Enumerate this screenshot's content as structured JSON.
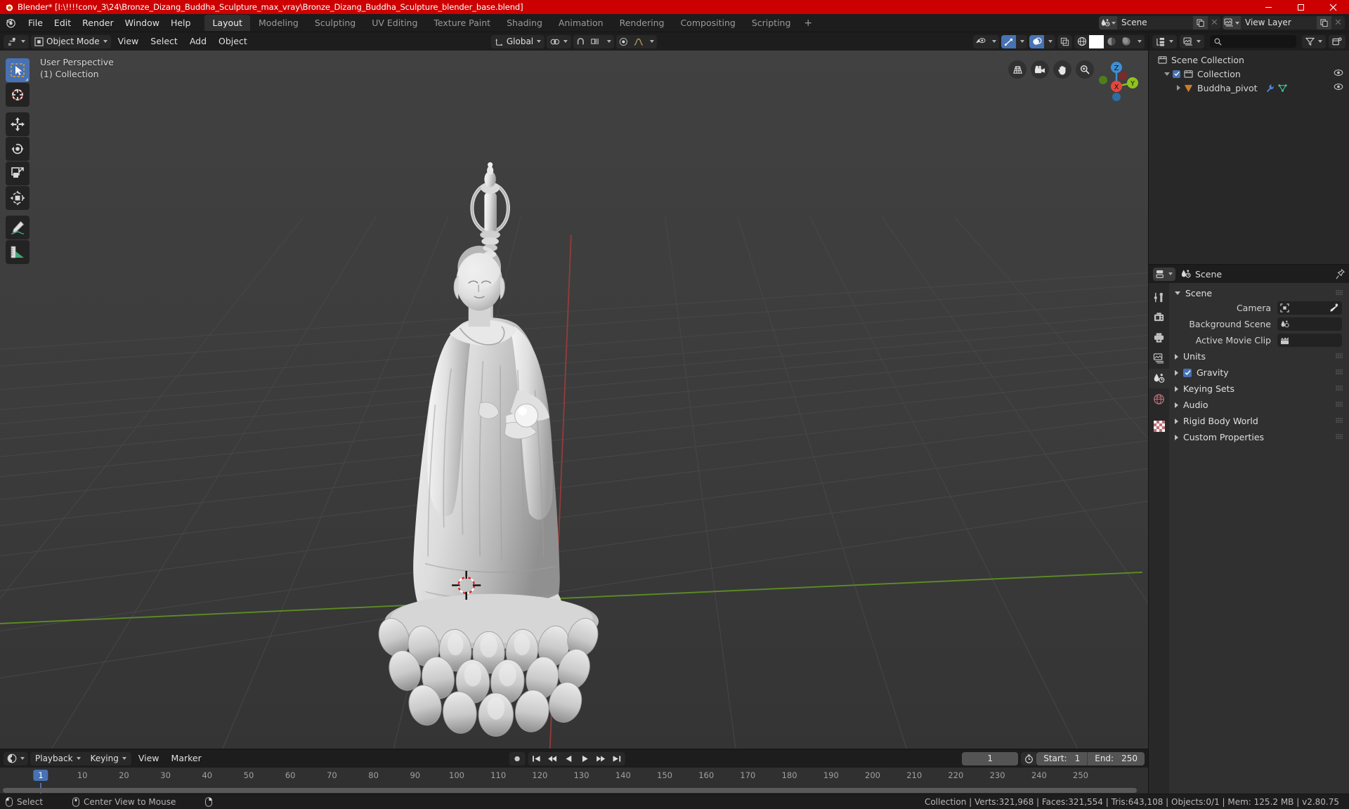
{
  "titlebar": {
    "title": "Blender* [I:\\!!!!conv_3\\24\\Bronze_Dizang_Buddha_Sculpture_max_vray\\Bronze_Dizang_Buddha_Sculpture_blender_base.blend]",
    "accent_color": "#cc0000",
    "minimize": "–",
    "maximize": "❐",
    "close": "✕"
  },
  "topbar": {
    "menus": [
      "File",
      "Edit",
      "Render",
      "Window",
      "Help"
    ],
    "workspace_tabs": [
      {
        "label": "Layout",
        "active": true
      },
      {
        "label": "Modeling",
        "active": false
      },
      {
        "label": "Sculpting",
        "active": false
      },
      {
        "label": "UV Editing",
        "active": false
      },
      {
        "label": "Texture Paint",
        "active": false
      },
      {
        "label": "Shading",
        "active": false
      },
      {
        "label": "Animation",
        "active": false
      },
      {
        "label": "Rendering",
        "active": false
      },
      {
        "label": "Compositing",
        "active": false
      },
      {
        "label": "Scripting",
        "active": false
      }
    ],
    "add_workspace": "+",
    "scene_name": "Scene",
    "view_layer_name": "View Layer"
  },
  "viewport_header": {
    "mode": "Object Mode",
    "menus": [
      "View",
      "Select",
      "Add",
      "Object"
    ],
    "transform_orientation": "Global",
    "shading_modes": [
      "wireframe",
      "solid",
      "material-preview",
      "rendered"
    ],
    "active_shading": "solid"
  },
  "viewport": {
    "perspective_label": "User Perspective",
    "collection_label": "(1) Collection",
    "gizmo_axes": [
      {
        "label": "Z",
        "color": "#3f8fd2"
      },
      {
        "label": "Y",
        "color": "#8fc31f"
      },
      {
        "label": "X",
        "color": "#e8453c"
      }
    ],
    "tools": [
      {
        "name": "tweak-select-box",
        "active": true
      },
      {
        "name": "cursor",
        "active": false
      },
      {
        "name": "move",
        "active": false
      },
      {
        "name": "rotate",
        "active": false
      },
      {
        "name": "scale",
        "active": false
      },
      {
        "name": "transform",
        "active": false
      },
      {
        "name": "annotate",
        "active": false
      },
      {
        "name": "measure",
        "active": false
      }
    ],
    "nav_icons": [
      "grid-toggle-icon",
      "camera-view-icon",
      "pan-hand-icon",
      "zoom-magnifier-icon"
    ]
  },
  "outliner": {
    "rows": [
      {
        "label": "Scene Collection",
        "indent": 0,
        "icon": "collection-icon",
        "has_eye": false,
        "has_checkbox": false,
        "has_triangle": false
      },
      {
        "label": "Collection",
        "indent": 1,
        "icon": "collection-icon",
        "has_eye": true,
        "has_checkbox": true,
        "has_triangle": true
      },
      {
        "label": "Buddha_pivot",
        "indent": 2,
        "icon": "empty-arrows-icon",
        "has_eye": true,
        "has_checkbox": false,
        "has_triangle": true,
        "extra_icons": [
          "wrench-modifier-icon",
          "mesh-data-icon"
        ]
      }
    ]
  },
  "properties": {
    "breadcrumb": "Scene",
    "tabs": [
      {
        "name": "tool-tab",
        "active": false
      },
      {
        "name": "render-tab",
        "active": false
      },
      {
        "name": "output-tab",
        "active": false
      },
      {
        "name": "view-layer-tab",
        "active": false
      },
      {
        "name": "scene-tab",
        "active": true
      },
      {
        "name": "world-tab",
        "active": false
      },
      {
        "name": "texture-tab",
        "active": false
      }
    ],
    "panels": [
      {
        "label": "Scene",
        "expanded": true
      },
      {
        "label": "Units",
        "expanded": false
      },
      {
        "label": "Gravity",
        "expanded": false,
        "checkbox": true
      },
      {
        "label": "Keying Sets",
        "expanded": false
      },
      {
        "label": "Audio",
        "expanded": false
      },
      {
        "label": "Rigid Body World",
        "expanded": false
      },
      {
        "label": "Custom Properties",
        "expanded": false
      }
    ],
    "fields": [
      {
        "label": "Camera",
        "value": "",
        "icon": "camera-data-icon",
        "eyedropper": true
      },
      {
        "label": "Background Scene",
        "value": "",
        "icon": "scene-icon",
        "eyedropper": false
      },
      {
        "label": "Active Movie Clip",
        "value": "",
        "icon": "movie-clip-icon",
        "eyedropper": false
      }
    ]
  },
  "timeline": {
    "menus": [
      "Playback",
      "Keying",
      "View",
      "Marker"
    ],
    "current_frame": "1",
    "start_label": "Start:",
    "start_value": "1",
    "end_label": "End:",
    "end_value": "250",
    "ticks": [
      "10",
      "20",
      "30",
      "40",
      "50",
      "60",
      "70",
      "80",
      "90",
      "100",
      "110",
      "120",
      "130",
      "140",
      "150",
      "160",
      "170",
      "180",
      "190",
      "200",
      "210",
      "220",
      "230",
      "240",
      "250"
    ],
    "playhead_frame": "1"
  },
  "statusbar": {
    "mouse_left_action": "Select",
    "mouse_middle_action": "Center View to Mouse",
    "stats": "Collection | Verts:321,968 | Faces:321,554 | Tris:643,108 | Objects:0/1 | Mem: 125.2 MB | v2.80.75"
  }
}
